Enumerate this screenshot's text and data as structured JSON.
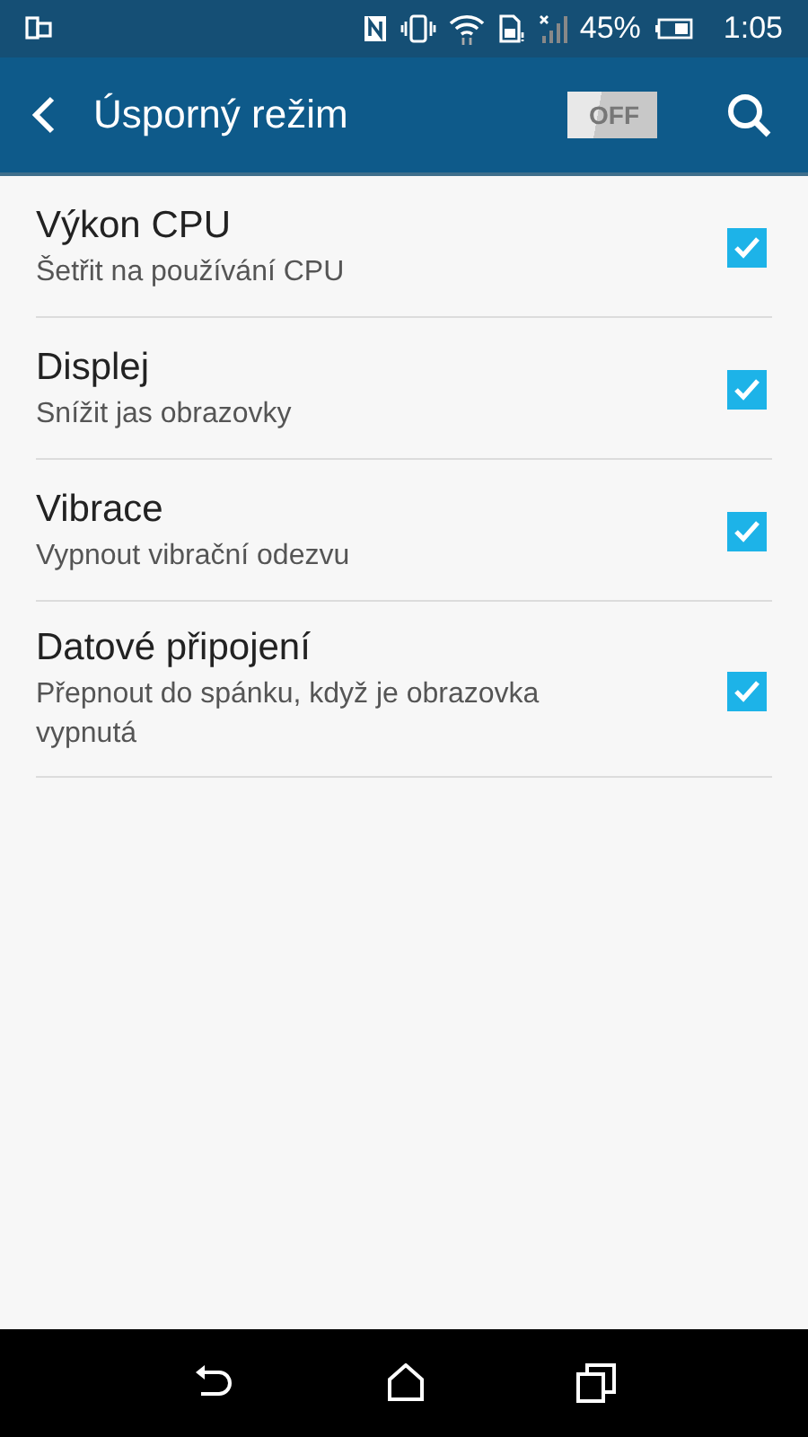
{
  "status_bar": {
    "battery": "45%",
    "time": "1:05"
  },
  "app_bar": {
    "title": "Úsporný režim",
    "toggle": {
      "label": "OFF",
      "on": false
    }
  },
  "items": [
    {
      "title": "Výkon CPU",
      "subtitle": "Šetřit na používání CPU",
      "checked": true
    },
    {
      "title": "Displej",
      "subtitle": "Snížit jas obrazovky",
      "checked": true
    },
    {
      "title": "Vibrace",
      "subtitle": "Vypnout vibrační odezvu",
      "checked": true
    },
    {
      "title": "Datové připojení",
      "subtitle": "Přepnout do spánku, když je obrazovka vypnutá",
      "checked": true
    }
  ]
}
